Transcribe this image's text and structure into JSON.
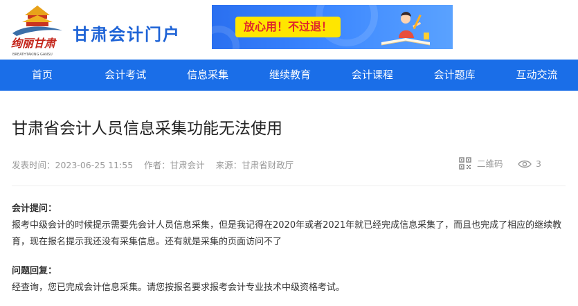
{
  "header": {
    "logo_text": "绚丽甘肃",
    "logo_subtext": "BREATHTAKING GANSU",
    "site_name": "甘肃会计门户",
    "banner_text": "放心用！不过退！"
  },
  "nav": {
    "items": [
      "首页",
      "会计考试",
      "信息采集",
      "继续教育",
      "会计课程",
      "会计题库",
      "互动交流"
    ]
  },
  "article": {
    "title": "甘肃省会计人员信息采集功能无法使用",
    "meta": {
      "publish_time": "发表时间：2023-06-25 11:55",
      "author": "作者：甘肃会计",
      "source": "来源：甘肃省财政厅",
      "qr_label": "二维码",
      "views": "3"
    },
    "question_label": "会计提问：",
    "question_text": "报考中级会计的时候提示需要先会计人员信息采集，但是我记得在2020年或者2021年就已经完成信息采集了，而且也完成了相应的继续教育，现在报名提示我还没有采集信息。还有就是采集的页面访问不了",
    "answer_label": "问题回复：",
    "answer_text": "经查询，您已完成会计信息采集。请您按报名要求报考会计专业技术中级资格考试。"
  },
  "colors": {
    "brand_blue": "#1a6ee8",
    "site_name": "#1e63d6",
    "banner_yellow": "#ffe600",
    "banner_red": "#e0272b"
  }
}
